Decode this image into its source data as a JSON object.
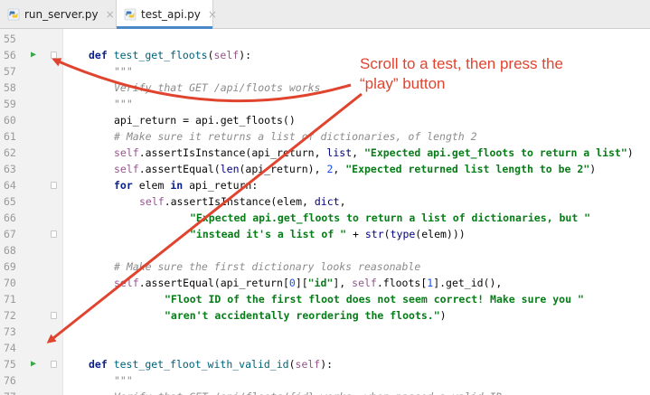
{
  "tabs": [
    {
      "label": "run_server.py",
      "icon": "python-file-icon",
      "active": false
    },
    {
      "label": "test_api.py",
      "icon": "python-file-icon",
      "active": true
    }
  ],
  "close_glyph": "×",
  "colors": {
    "run_arrow": "#3aa84a",
    "annotation": "#e0442f",
    "tab_accent": "#4a88c7"
  },
  "annotation": {
    "line1": "Scroll to a test, then press the",
    "line2": "“play” button"
  },
  "lines": [
    {
      "n": "55",
      "text": ""
    },
    {
      "n": "56",
      "text": "def test_get_floots(self):"
    },
    {
      "n": "57",
      "text": "\"\"\""
    },
    {
      "n": "58",
      "text": "Verify that GET /api/floots works"
    },
    {
      "n": "59",
      "text": "\"\"\""
    },
    {
      "n": "60",
      "text": "api_return = api.get_floots()"
    },
    {
      "n": "61",
      "text": "# Make sure it returns a list of dictionaries, of length 2"
    },
    {
      "n": "62",
      "text": "self.assertIsInstance(api_return, list, \"Expected api.get_floots to return a list\")"
    },
    {
      "n": "63",
      "text": "self.assertEqual(len(api_return), 2, \"Expected returned list length to be 2\")"
    },
    {
      "n": "64",
      "text": "for elem in api_return:"
    },
    {
      "n": "65",
      "text": "self.assertIsInstance(elem, dict,"
    },
    {
      "n": "66",
      "text": "\"Expected api.get_floots to return a list of dictionaries, but \""
    },
    {
      "n": "67",
      "text": "\"instead it's a list of \" + str(type(elem)))"
    },
    {
      "n": "68",
      "text": ""
    },
    {
      "n": "69",
      "text": "# Make sure the first dictionary looks reasonable"
    },
    {
      "n": "70",
      "text": "self.assertEqual(api_return[0][\"id\"], self.floots[1].get_id(),"
    },
    {
      "n": "71",
      "text": "\"Floot ID of the first floot does not seem correct! Make sure you \""
    },
    {
      "n": "72",
      "text": "\"aren't accidentally reordering the floots.\")"
    },
    {
      "n": "73",
      "text": ""
    },
    {
      "n": "74",
      "text": ""
    },
    {
      "n": "75",
      "text": "def test_get_floot_with_valid_id(self):"
    },
    {
      "n": "76",
      "text": "\"\"\""
    },
    {
      "n": "77",
      "text": "Verify that GET /api/floots/{id} works, when passed a valid ID"
    }
  ]
}
